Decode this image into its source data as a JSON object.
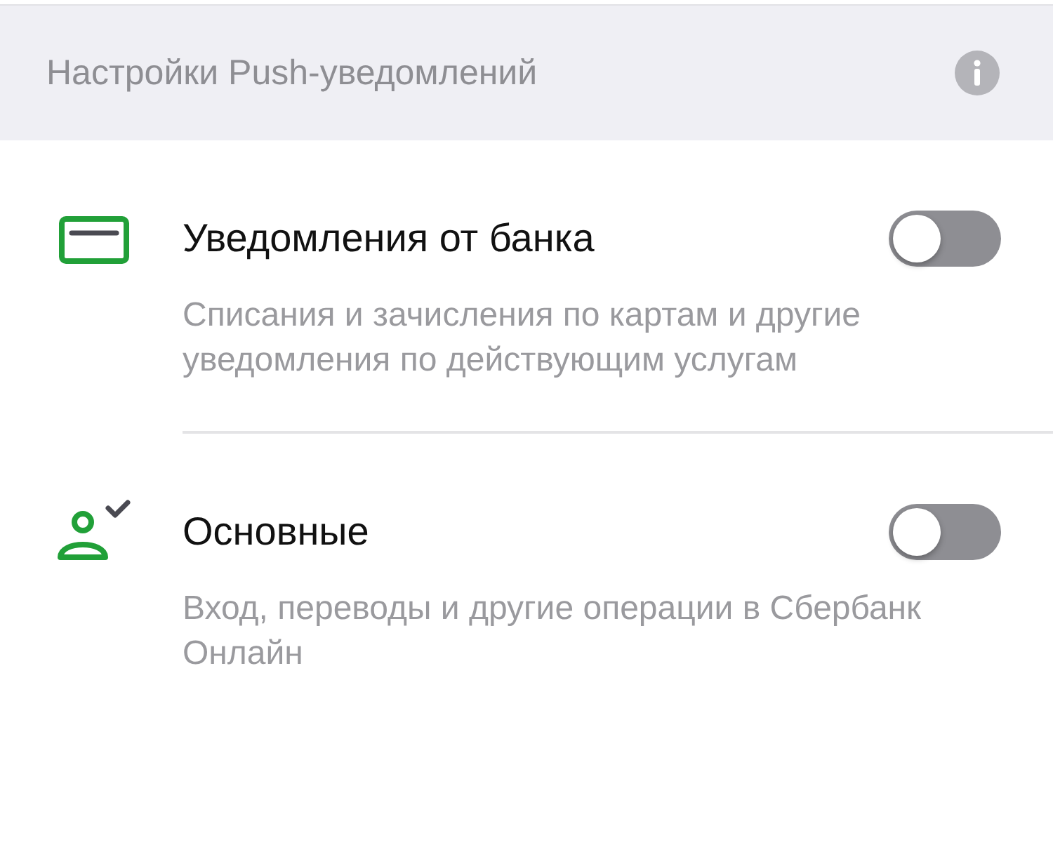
{
  "header": {
    "title": "Настройки Push-уведомлений"
  },
  "items": [
    {
      "kind": "card",
      "title": "Уведомления от банка",
      "description": "Списания и зачисления по картам и другие уведомления по действующим услугам",
      "on": false
    },
    {
      "kind": "user",
      "title": "Основные",
      "description": "Вход, переводы и другие операции в Сбербанк Онлайн",
      "on": false
    }
  ]
}
